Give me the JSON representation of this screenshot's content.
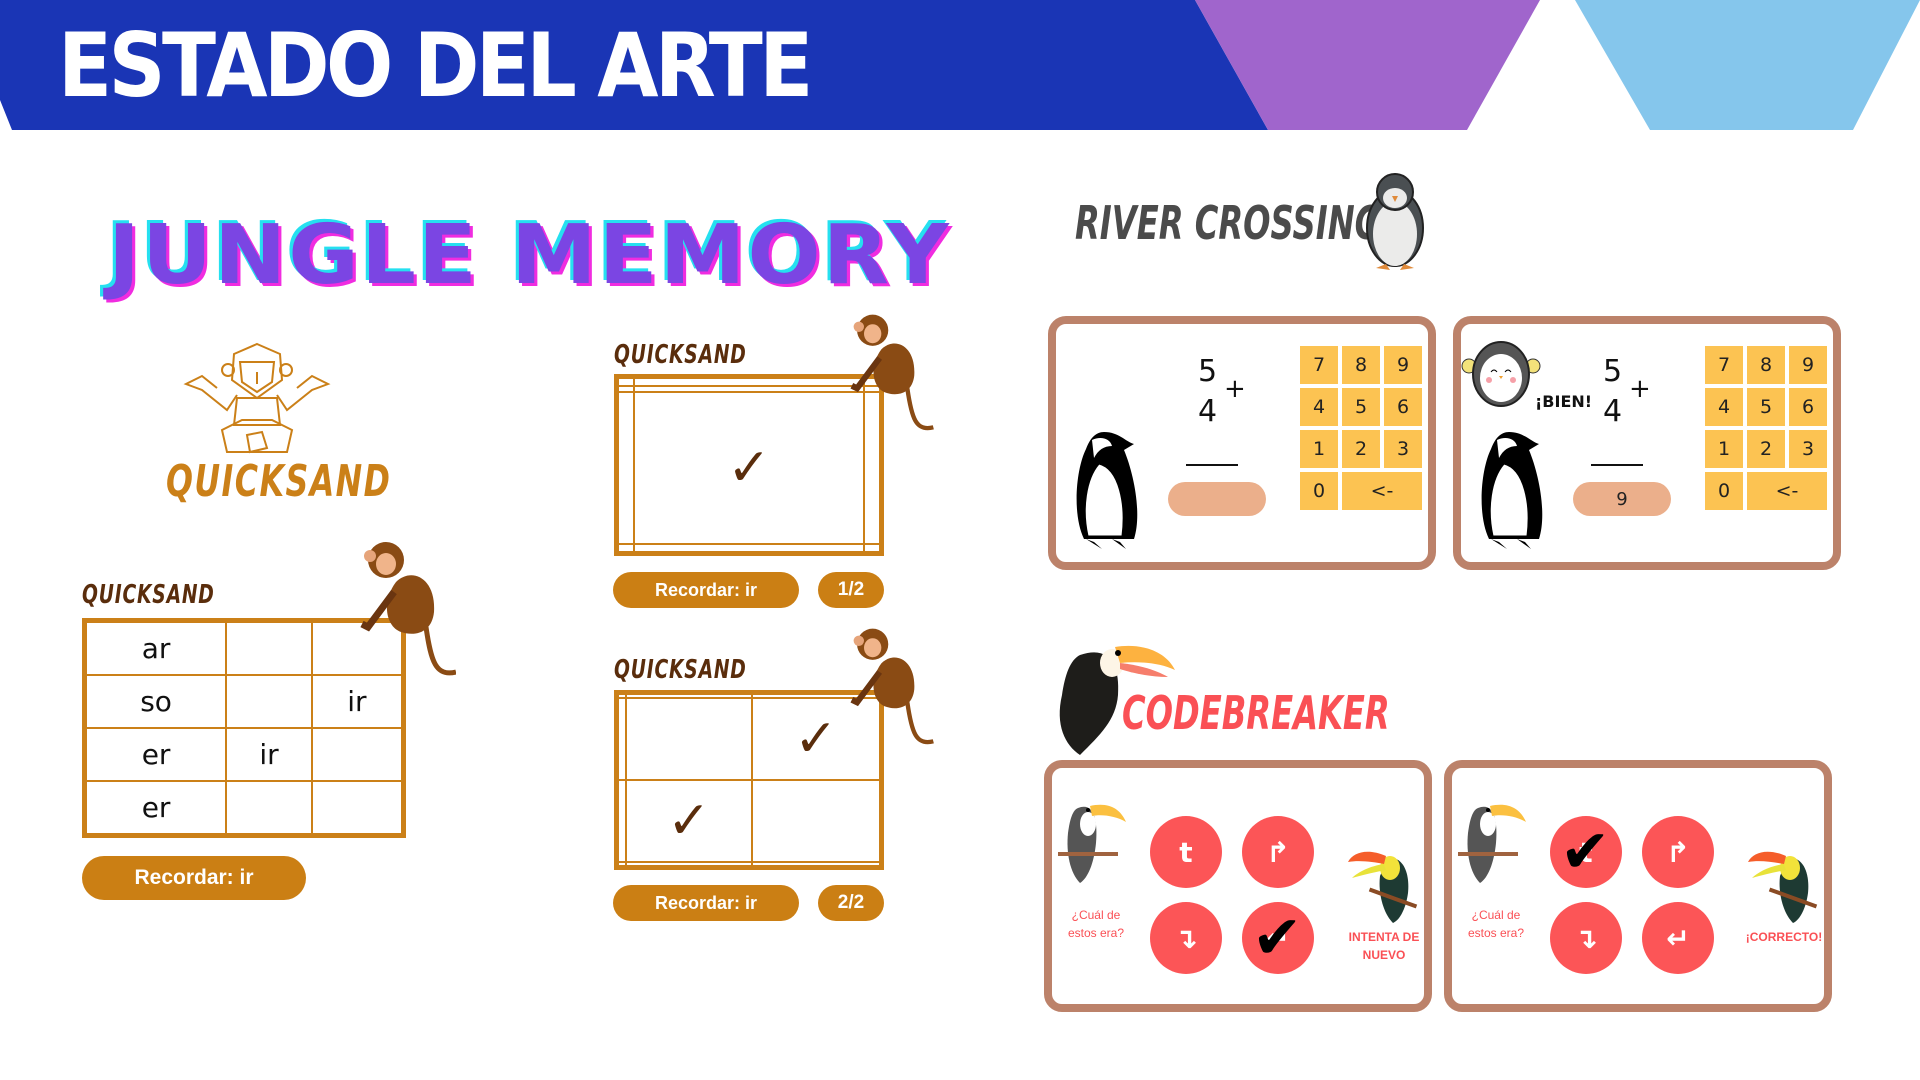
{
  "header": {
    "title": "ESTADO DEL ARTE"
  },
  "jungle_memory": {
    "title": "JUNGLE MEMORY",
    "logo_label": "QUICKSAND",
    "grid_main": {
      "label": "QUICKSAND",
      "rows": [
        [
          "ar",
          "",
          ""
        ],
        [
          "so",
          "",
          "ir"
        ],
        [
          "er",
          "ir",
          ""
        ],
        [
          "er",
          "",
          ""
        ]
      ],
      "pill": "Recordar: ir"
    },
    "grid_step1": {
      "label": "QUICKSAND",
      "pill": "Recordar: ir",
      "counter": "1/2",
      "checks": [
        [
          2,
          1
        ]
      ]
    },
    "grid_step2": {
      "label": "QUICKSAND",
      "pill": "Recordar: ir",
      "counter": "2/2",
      "checks": [
        [
          1,
          2
        ],
        [
          2,
          1
        ]
      ]
    }
  },
  "river_crossing": {
    "title": "RIVER CROSSING",
    "cards": [
      {
        "top": "5",
        "bottom": "4",
        "op": "+",
        "answer": "",
        "feedback": ""
      },
      {
        "top": "5",
        "bottom": "4",
        "op": "+",
        "answer": "9",
        "feedback": "¡BIEN!"
      }
    ],
    "keys": [
      "7",
      "8",
      "9",
      "4",
      "5",
      "6",
      "1",
      "2",
      "3",
      "0",
      "<-"
    ]
  },
  "codebreaker": {
    "title": "CODEBREAKER",
    "prompt": "¿Cuál de estos era?",
    "cards": [
      {
        "symbols": [
          "t",
          "↱",
          "↴",
          "↵"
        ],
        "checked": 3,
        "result": "INTENTA DE NUEVO"
      },
      {
        "symbols": [
          "t",
          "↱",
          "↴",
          "↵"
        ],
        "checked": 0,
        "result": "¡CORRECTO!"
      }
    ]
  }
}
